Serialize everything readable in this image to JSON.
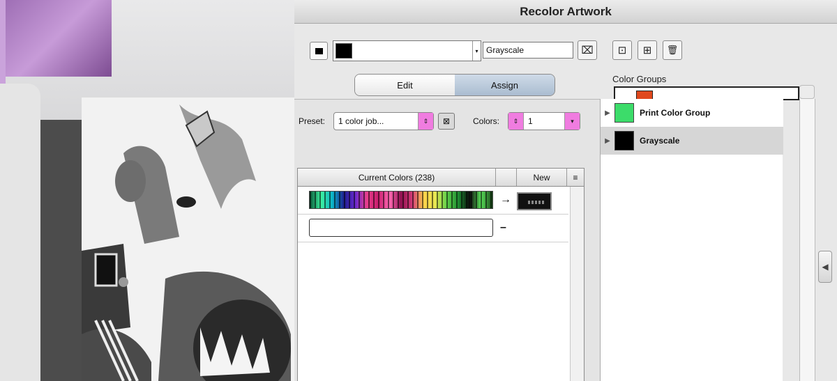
{
  "window": {
    "title": "Recolor Artwork"
  },
  "toolbar": {
    "harmony_name_value": "Grayscale",
    "dropdown_arrow": "▾",
    "eyedropper_glyph": "⌧",
    "save_glyph": "⊡",
    "new_group_glyph": "⊞",
    "delete_glyph": "🗑"
  },
  "tabs": {
    "edit": "Edit",
    "assign": "Assign"
  },
  "color_groups": {
    "label": "Color Groups",
    "items": [
      {
        "name": "Print Color Group",
        "swatch": "#3cdc6a",
        "selected": false
      },
      {
        "name": "Grayscale",
        "swatch": "#000000",
        "selected": true
      }
    ]
  },
  "assign": {
    "preset_label": "Preset:",
    "preset_value": "1 color job...",
    "colors_label": "Colors:",
    "colors_value": "1",
    "current_colors_header": "Current Colors (238)",
    "new_header": "New",
    "new_menu_glyph": "≡",
    "arrow_glyph": "→",
    "dash_glyph": "–"
  },
  "colors": {
    "accent_pink": "#f07ce0",
    "assign_tab": "#aabcd0",
    "print_group": "#3cdc6a",
    "grayscale": "#000000"
  }
}
